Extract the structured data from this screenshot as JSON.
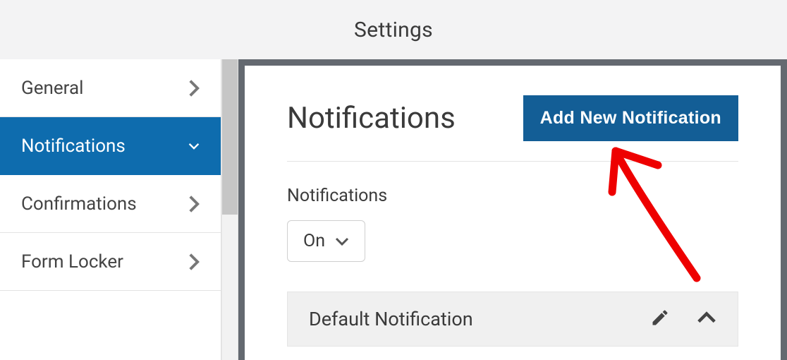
{
  "header": {
    "title": "Settings"
  },
  "sidebar": {
    "items": [
      {
        "label": "General"
      },
      {
        "label": "Notifications"
      },
      {
        "label": "Confirmations"
      },
      {
        "label": "Form Locker"
      }
    ]
  },
  "main": {
    "title": "Notifications",
    "add_button_label": "Add New Notification",
    "toggle": {
      "label": "Notifications",
      "value": "On"
    },
    "accordion": {
      "title": "Default Notification"
    }
  }
}
